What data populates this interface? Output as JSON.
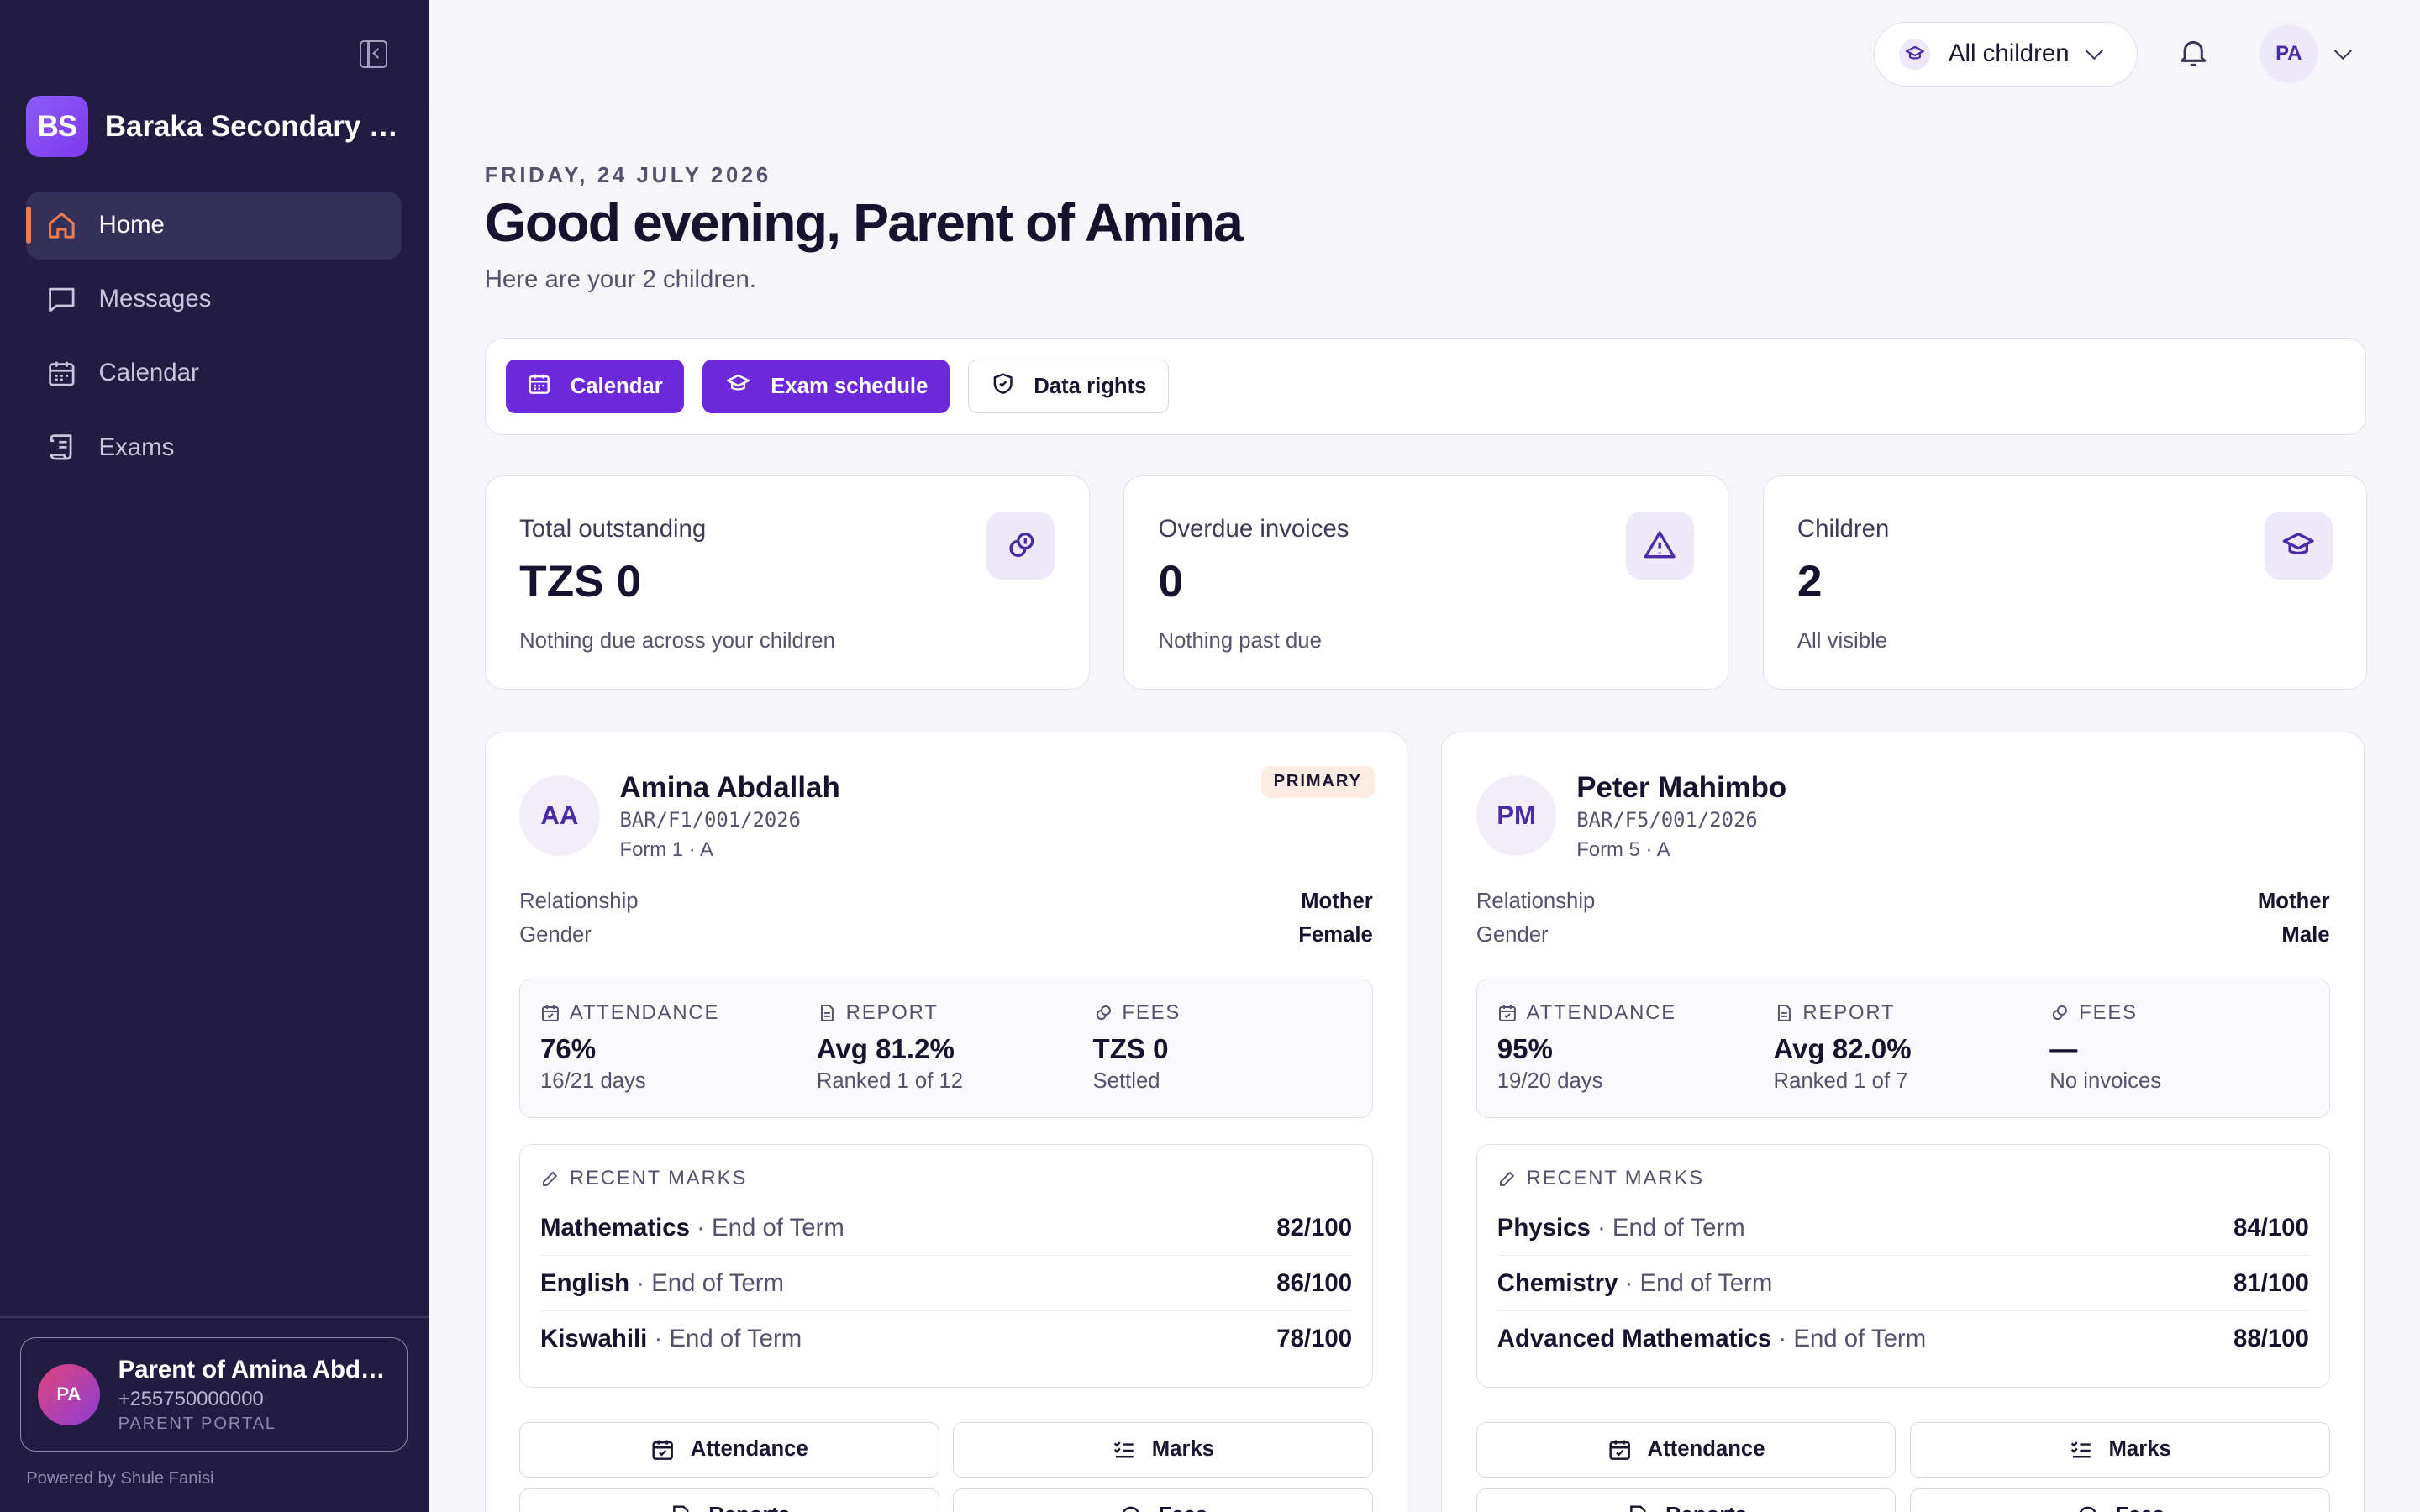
{
  "sidebar": {
    "brand_initials": "BS",
    "brand_name": "Baraka Secondary School",
    "nav": [
      {
        "label": "Home",
        "icon": "home-icon",
        "active": true
      },
      {
        "label": "Messages",
        "icon": "message-icon"
      },
      {
        "label": "Calendar",
        "icon": "calendar-icon"
      },
      {
        "label": "Exams",
        "icon": "scroll-icon"
      }
    ],
    "profile": {
      "initials": "PA",
      "name": "Parent of Amina Abdallah",
      "phone": "+255750000000",
      "role": "PARENT PORTAL"
    },
    "powered_by": "Powered by Shule Fanisi"
  },
  "topbar": {
    "child_filter": "All children",
    "user_initials": "PA"
  },
  "page": {
    "date": "FRIDAY, 24 JULY 2026",
    "greeting": "Good evening, Parent of Amina",
    "subtitle": "Here are your 2 children."
  },
  "actions": [
    {
      "label": "Calendar",
      "icon": "calendar-icon",
      "style": "primary"
    },
    {
      "label": "Exam schedule",
      "icon": "graduation-cap-icon",
      "style": "primary"
    },
    {
      "label": "Data rights",
      "icon": "shield-icon",
      "style": "outline"
    }
  ],
  "stats": [
    {
      "label": "Total outstanding",
      "value": "TZS 0",
      "sub": "Nothing due across your children",
      "icon": "coins-icon"
    },
    {
      "label": "Overdue invoices",
      "value": "0",
      "sub": "Nothing past due",
      "icon": "warning-icon"
    },
    {
      "label": "Children",
      "value": "2",
      "sub": "All visible",
      "icon": "graduation-cap-icon"
    }
  ],
  "labels": {
    "relationship": "Relationship",
    "gender": "Gender",
    "attendance": "ATTENDANCE",
    "report": "REPORT",
    "fees": "FEES",
    "recent_marks": "RECENT MARKS",
    "btn_attendance": "Attendance",
    "btn_marks": "Marks",
    "btn_reports": "Reports",
    "btn_fees": "Fees"
  },
  "children": [
    {
      "initials": "AA",
      "name": "Amina Abdallah",
      "reg": "BAR/F1/001/2026",
      "form": "Form 1 · A",
      "badge": "PRIMARY",
      "relationship": "Mother",
      "gender": "Female",
      "attendance": {
        "value": "76%",
        "sub": "16/21 days"
      },
      "report": {
        "value": "Avg 81.2%",
        "sub": "Ranked 1 of 12"
      },
      "fees": {
        "value": "TZS 0",
        "sub": "Settled"
      },
      "marks": [
        {
          "subject": "Mathematics",
          "term": " · End of Term",
          "score": "82/100"
        },
        {
          "subject": "English",
          "term": " · End of Term",
          "score": "86/100"
        },
        {
          "subject": "Kiswahili",
          "term": " · End of Term",
          "score": "78/100"
        }
      ]
    },
    {
      "initials": "PM",
      "name": "Peter Mahimbo",
      "reg": "BAR/F5/001/2026",
      "form": "Form 5 · A",
      "badge": "",
      "relationship": "Mother",
      "gender": "Male",
      "attendance": {
        "value": "95%",
        "sub": "19/20 days"
      },
      "report": {
        "value": "Avg 82.0%",
        "sub": "Ranked 1 of 7"
      },
      "fees": {
        "value": "—",
        "sub": "No invoices"
      },
      "marks": [
        {
          "subject": "Physics",
          "term": " · End of Term",
          "score": "84/100"
        },
        {
          "subject": "Chemistry",
          "term": " · End of Term",
          "score": "81/100"
        },
        {
          "subject": "Advanced Mathematics",
          "term": " · End of Term",
          "score": "88/100"
        }
      ]
    }
  ],
  "colors": {
    "sidebar_bg": "#221c42",
    "accent": "#6d28d9",
    "active_indicator": "#f07a4a"
  }
}
